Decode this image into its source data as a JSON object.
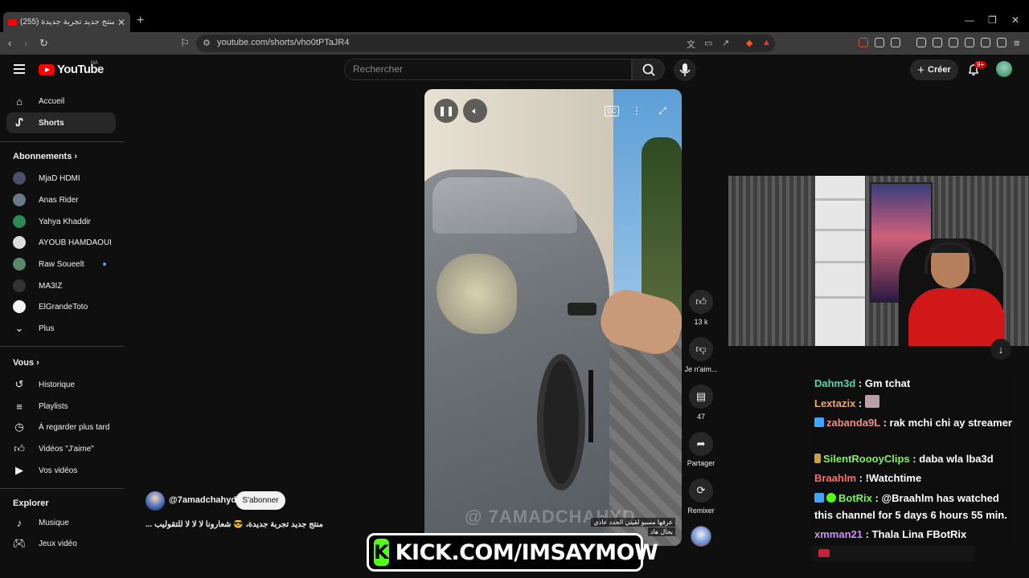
{
  "browser": {
    "tab_title": "(255) منتج جديد تجربة جديدة، ...",
    "url": "youtube.com/shorts/vho0tPTaJR4"
  },
  "youtube": {
    "logo_text": "YouTube",
    "country_code": "MA",
    "search_placeholder": "Rechercher",
    "create_label": "Créer",
    "notif_count": "9+"
  },
  "sidebar": {
    "main": [
      {
        "label": "Accueil",
        "icon": "home-icon"
      },
      {
        "label": "Shorts",
        "icon": "shorts-icon",
        "active": true
      }
    ],
    "subscriptions_heading": "Abonnements",
    "subscriptions": [
      {
        "label": "MjaD HDMI",
        "color": "#556"
      },
      {
        "label": "Anas Rider",
        "color": "#789"
      },
      {
        "label": "Yahya Khaddir",
        "color": "#3a6"
      },
      {
        "label": "AYOUB HAMDAOUI",
        "color": "#ddd"
      },
      {
        "label": "Raw Soueelt",
        "color": "#6a7",
        "live": true
      },
      {
        "label": "MA3IZ",
        "color": "#333"
      },
      {
        "label": "ElGrandeToto",
        "color": "#fff"
      }
    ],
    "more_label": "Plus",
    "you_heading": "Vous",
    "you_items": [
      {
        "label": "Historique",
        "icon": "history-icon"
      },
      {
        "label": "Playlists",
        "icon": "playlists-icon"
      },
      {
        "label": "À regarder plus tard",
        "icon": "watch-later-icon"
      },
      {
        "label": "Vidéos \"J'aime\"",
        "icon": "liked-icon"
      },
      {
        "label": "Vos vidéos",
        "icon": "your-videos-icon"
      }
    ],
    "explore_heading": "Explorer",
    "explore_items": [
      {
        "label": "Musique",
        "icon": "music-icon"
      },
      {
        "label": "Jeux vidéo",
        "icon": "gaming-icon"
      }
    ]
  },
  "short": {
    "watermark": "@ 7AMADCHAHYD",
    "caption_line1": "عرفها مسيو لقيتي الحدد عادي",
    "caption_line2": "بحال هاد",
    "like_count": "13 k",
    "dislike_label": "Je n'aim...",
    "comment_count": "47",
    "share_label": "Partager",
    "remix_label": "Remixer",
    "channel_name": "@7amadchahyd",
    "subscribe_label": "S'abonner",
    "title": "منتج جديد تجربة جديدة، 😎 شعارونا لا لا لا للتقوليب ..."
  },
  "chat": {
    "messages": [
      {
        "user": "Dahm3d",
        "color": "#4fd6b0",
        "text": "Gm tchat"
      },
      {
        "user": "Lextazix",
        "color": "#e8a96b",
        "text": "",
        "emote": true
      },
      {
        "user": "zabanda9L",
        "color": "#f28d8d",
        "text": "rak mchi chi ay streamer",
        "badge": "#3ea6ff"
      },
      {
        "user": "SilentRoooyClips",
        "color": "#7ff25a",
        "text": "daba wla lba3d",
        "badge": "#c8a040"
      },
      {
        "user": "Braahlm",
        "color": "#ff6a6a",
        "text": "!Watchtime"
      },
      {
        "user": "BotRix",
        "color": "#7ff25a",
        "text": "@Braahlm has watched this channel for 5 days 6 hours 55 min.",
        "badge": "#3ea6ff"
      },
      {
        "user": "xmman21",
        "color": "#d08cff",
        "text": "Thala Lina FBotRix"
      }
    ]
  },
  "kick_banner": {
    "logo_letter": "K",
    "text": "KICK.COM/IMSAYMOW"
  },
  "colors": {
    "youtube_red": "#ff0000",
    "kick_green": "#53fc18",
    "background": "#0f0f0f"
  }
}
